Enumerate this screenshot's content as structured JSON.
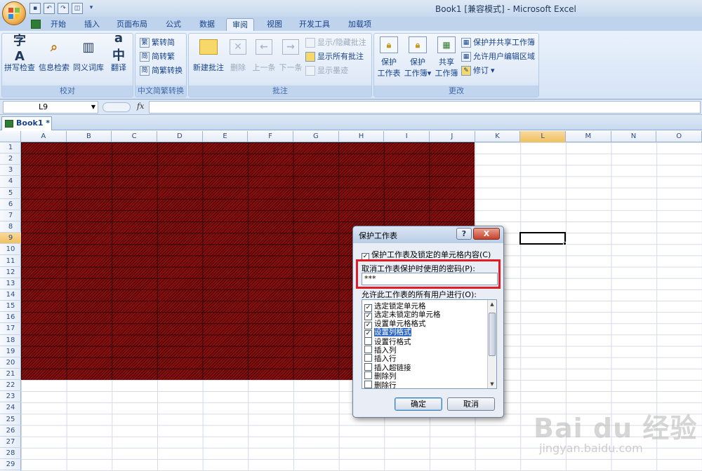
{
  "window": {
    "title": "Book1  [兼容模式] - Microsoft Excel"
  },
  "quick_access": [
    "save-icon",
    "undo-icon",
    "redo-icon",
    "print-preview-icon"
  ],
  "ribbon": {
    "tabs": [
      {
        "label": "开始",
        "active": false
      },
      {
        "label": "插入",
        "active": false
      },
      {
        "label": "页面布局",
        "active": false
      },
      {
        "label": "公式",
        "active": false
      },
      {
        "label": "数据",
        "active": false
      },
      {
        "label": "审阅",
        "active": true
      },
      {
        "label": "视图",
        "active": false
      },
      {
        "label": "开发工具",
        "active": false
      },
      {
        "label": "加载项",
        "active": false
      }
    ],
    "groups": {
      "proofing": {
        "label": "校对",
        "buttons": [
          "拼写检查",
          "信息检索",
          "同义词库",
          "翻译"
        ]
      },
      "chinese_conversion": {
        "label": "中文简繁转换",
        "buttons": [
          "繁转简",
          "简转繁",
          "简繁转换"
        ]
      },
      "comments": {
        "label": "批注",
        "buttons": [
          "新建批注",
          "删除",
          "上一条",
          "下一条"
        ],
        "small_buttons": [
          "显示/隐藏批注",
          "显示所有批注",
          "显示墨迹"
        ]
      },
      "changes": {
        "label": "更改",
        "protect_sheet": [
          "保护",
          "工作表"
        ],
        "protect_workbook": [
          "保护",
          "工作簿"
        ],
        "share_workbook": [
          "共享",
          "工作簿"
        ],
        "small_buttons": [
          "保护并共享工作簿",
          "允许用户编辑区域",
          "修订"
        ]
      }
    }
  },
  "formula_bar": {
    "name_box": "L9",
    "fx": "fx",
    "formula": ""
  },
  "workbook_tab": "Book1 *",
  "grid": {
    "columns": [
      "A",
      "B",
      "C",
      "D",
      "E",
      "F",
      "G",
      "H",
      "I",
      "J",
      "K",
      "L",
      "M",
      "N",
      "O"
    ],
    "selected_column": "L",
    "rows": [
      "1",
      "2",
      "3",
      "4",
      "5",
      "6",
      "7",
      "8",
      "9",
      "10",
      "11",
      "12",
      "13",
      "14",
      "15",
      "16",
      "17",
      "18",
      "19",
      "20",
      "21",
      "22",
      "23",
      "24",
      "25",
      "26",
      "27",
      "28",
      "29"
    ],
    "selected_row": "9",
    "fill_color": "#8c0f0f",
    "filled_range": "A1:J21"
  },
  "dialog": {
    "title": "保护工作表",
    "help": "?",
    "close": "X",
    "protect_checkbox_label": "保护工作表及锁定的单元格内容(C)",
    "protect_checked": true,
    "password_label": "取消工作表保护时使用的密码(P):",
    "password_value": "***",
    "permissions_label": "允许此工作表的所有用户进行(O):",
    "permissions": [
      {
        "label": "选定锁定单元格",
        "checked": true,
        "selected": false
      },
      {
        "label": "选定未锁定的单元格",
        "checked": true,
        "selected": false
      },
      {
        "label": "设置单元格格式",
        "checked": true,
        "selected": false
      },
      {
        "label": "设置列格式",
        "checked": true,
        "selected": true
      },
      {
        "label": "设置行格式",
        "checked": false,
        "selected": false
      },
      {
        "label": "插入列",
        "checked": false,
        "selected": false
      },
      {
        "label": "插入行",
        "checked": false,
        "selected": false
      },
      {
        "label": "插入超链接",
        "checked": false,
        "selected": false
      },
      {
        "label": "删除列",
        "checked": false,
        "selected": false
      },
      {
        "label": "删除行",
        "checked": false,
        "selected": false
      }
    ],
    "ok": "确定",
    "cancel": "取消",
    "highlight_color": "#e31c23"
  },
  "watermark": {
    "logo": "Bai du 经验",
    "url": "jingyan.baidu.com"
  }
}
